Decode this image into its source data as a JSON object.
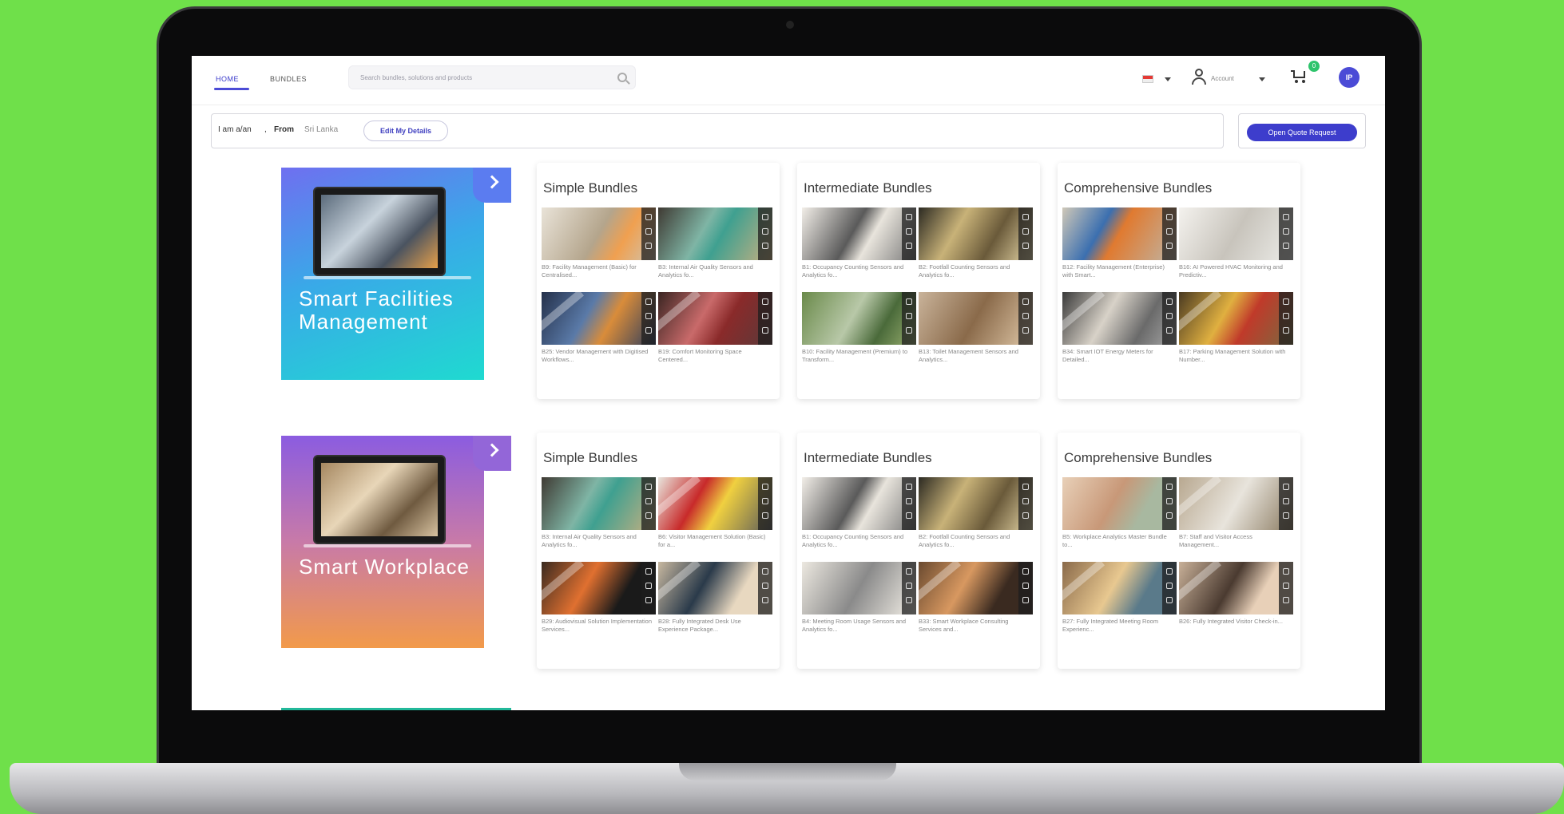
{
  "nav": {
    "home": "HOME",
    "bundles": "BUNDLES",
    "search_placeholder": "Search bundles, solutions and products",
    "account": "Account",
    "cart_count": "0",
    "avatar_initials": "IP"
  },
  "infobar": {
    "i_am_label": "I am a/an",
    "from_label": "From",
    "from_value": "Sri Lanka",
    "edit_button": "Edit My Details",
    "quote_button": "Open Quote Request"
  },
  "categories": [
    {
      "title": "Smart Facilities Management",
      "columns": [
        {
          "title": "Simple Bundles",
          "items": [
            "B9: Facility Management (Basic) for Centralised...",
            "B3: Internal Air Quality Sensors and Analytics fo...",
            "B25: Vendor Management with Digitised Workflows...",
            "B19: Comfort Monitoring Space Centered..."
          ]
        },
        {
          "title": "Intermediate Bundles",
          "items": [
            "B1: Occupancy Counting Sensors and Analytics fo...",
            "B2: Footfall Counting Sensors and Analytics fo...",
            "B10: Facility Management (Premium) to Transform...",
            "B13: Toilet Management Sensors and Analytics..."
          ]
        },
        {
          "title": "Comprehensive Bundles",
          "items": [
            "B12: Facility Management (Enterprise) with Smart...",
            "B16: AI Powered HVAC Monitoring and Predictiv...",
            "B34: Smart IOT Energy Meters for Detailed...",
            "B17: Parking Management Solution with Number..."
          ]
        }
      ]
    },
    {
      "title": "Smart Workplace",
      "columns": [
        {
          "title": "Simple Bundles",
          "items": [
            "B3: Internal Air Quality Sensors and Analytics fo...",
            "B6: Visitor Management Solution (Basic) for a...",
            "B29: Audiovisual Solution Implementation Services...",
            "B28: Fully Integrated Desk Use Experience Package..."
          ]
        },
        {
          "title": "Intermediate Bundles",
          "items": [
            "B1: Occupancy Counting Sensors and Analytics fo...",
            "B2: Footfall Counting Sensors and Analytics fo...",
            "B4: Meeting Room Usage Sensors and Analytics fo...",
            "B33: Smart Workplace Consulting Services and..."
          ]
        },
        {
          "title": "Comprehensive Bundles",
          "items": [
            "B5: Workplace Analytics Master Bundle to...",
            "B7: Staff and Visitor Access Management...",
            "B27: Fully Integrated Meeting Room Experienc...",
            "B26: Fully Integrated Visitor Check-in..."
          ]
        }
      ]
    }
  ]
}
